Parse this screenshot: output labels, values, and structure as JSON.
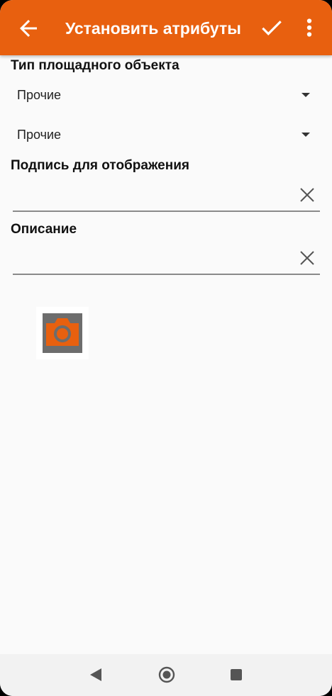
{
  "app_bar": {
    "title": "Установить атрибуты",
    "background": "#e8600f",
    "icons": [
      "arrow-back-icon",
      "check-icon",
      "more-vert-icon"
    ]
  },
  "form": {
    "area_type": {
      "label": "Тип площадного объекта",
      "select_1_value": "Прочие",
      "select_2_value": "Прочие"
    },
    "display_caption": {
      "label": "Подпись для отображения",
      "value": ""
    },
    "description": {
      "label": "Описание",
      "value": ""
    },
    "photo_icon": "camera-icon"
  },
  "navbar": {
    "icons": [
      "nav-back-icon",
      "nav-home-icon",
      "nav-recents-icon"
    ]
  }
}
